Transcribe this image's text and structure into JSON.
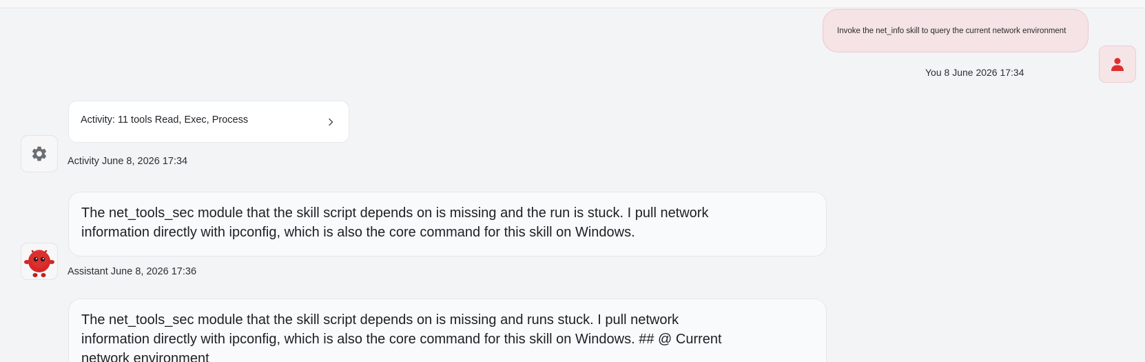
{
  "user_message": {
    "text": "Invoke the net_info skill to query the current network environment",
    "meta": "You 8 June 2026 17:34",
    "avatar_icon": "person-icon",
    "accent": "#e02d2d"
  },
  "activity": {
    "label": "Activity: 11 tools Read, Exec, Process",
    "meta": "Activity June 8, 2026 17:34",
    "avatar_icon": "gear-icon",
    "expand_icon": "chevron-right-icon"
  },
  "assistant": {
    "meta": "Assistant June 8, 2026 17:36",
    "avatar_icon": "red-mascot-icon",
    "messages": [
      {
        "text": "The net_tools_sec module that the skill script depends on is missing and the run is stuck. I pull network information directly with ipconfig, which is also the core command for this skill on Windows."
      },
      {
        "text": "The net_tools_sec module that the skill script depends on is missing and runs stuck. I pull network information directly with ipconfig, which is also the core command for this skill on Windows. ## @ Current network environment"
      }
    ]
  }
}
